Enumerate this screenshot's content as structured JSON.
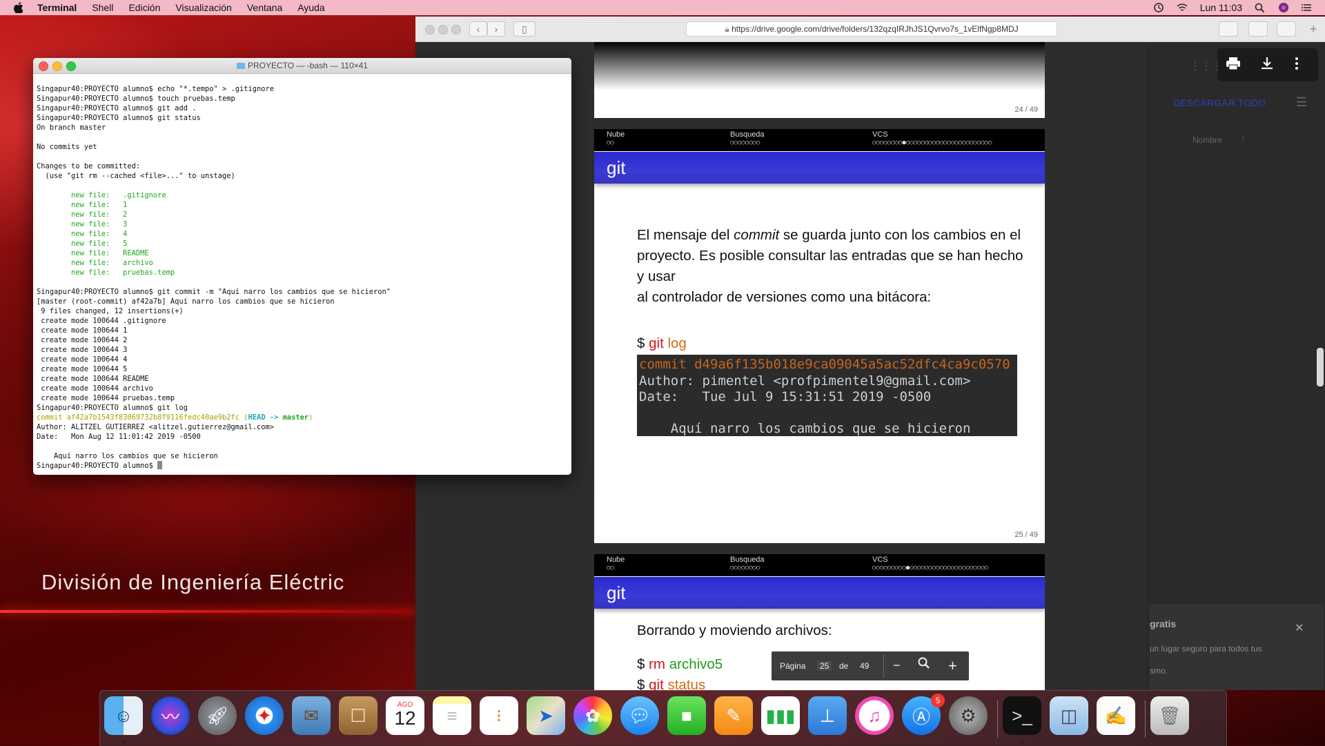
{
  "menubar": {
    "app": "Terminal",
    "items": [
      "Shell",
      "Edición",
      "Visualización",
      "Ventana",
      "Ayuda"
    ],
    "clock": "Lun 11:03"
  },
  "desktop": {
    "wallpaper_text": "División de Ingeniería Eléctric"
  },
  "browser": {
    "url": "https://drive.google.com/drive/folders/132qzqIRJhJS1Qvrvo7s_1vElfNgp8MDJ",
    "download_all": "DESCARGAR TODO",
    "column_name": "Nombre",
    "promo_title": "gratis",
    "promo_lines": [
      "un lugar seguro para todos tus",
      "smo."
    ],
    "pager": {
      "label": "Página",
      "current": "25",
      "of": "de",
      "total": "49"
    }
  },
  "slides": [
    {
      "page": "24 / 49"
    },
    {
      "sections": [
        {
          "name": "Nube",
          "dots": "○○"
        },
        {
          "name": "Busqueda",
          "dots": "○○○○○○○○"
        },
        {
          "name": "VCS",
          "dots": "○○○○○○○○●○○○○○○○○○○○○○○○○○○○○○○○"
        }
      ],
      "title": "git",
      "text": "El mensaje del commit se guarda junto con los cambios en el proyecto. Es posible consultar las entradas que se han hecho y usar al controlador de versiones como una bitácora:",
      "text_parts": {
        "a": "El mensaje del ",
        "em": "commit",
        "b": " se guarda junto con los cambios en el",
        "line2": "proyecto. Es posible consultar las entradas que se han hecho y usar",
        "line3": "al controlador de versiones como una bitácora:"
      },
      "command": {
        "prompt": "$",
        "cmd": "git",
        "arg": "log"
      },
      "terminal_lines": [
        "commit d49a6f135b018e9ca09045a5ac52dfc4ca9c0570",
        "Author: pimentel <profpimentel9@gmail.com>",
        "Date:   Tue Jul 9 15:31:51 2019 -0500",
        "    Aquí narro los cambios que se hicieron"
      ],
      "page": "25 / 49"
    },
    {
      "sections": [
        {
          "name": "Nube",
          "dots": "○○"
        },
        {
          "name": "Busqueda",
          "dots": "○○○○○○○○"
        },
        {
          "name": "VCS",
          "dots": "○○○○○○○○○●○○○○○○○○○○○○○○○○○○○○○"
        }
      ],
      "title": "git",
      "text": "Borrando y moviendo archivos:",
      "commands": [
        {
          "prompt": "$",
          "cmd": "rm",
          "arg": "archivo5"
        },
        {
          "prompt": "$",
          "cmd": "git",
          "arg": "status"
        }
      ]
    }
  ],
  "terminal": {
    "title": "PROYECTO — -bash — 110×41",
    "lines": [
      {
        "t": "Singapur40:PROYECTO alumno$ echo \"*.tempo\" > .gitignore",
        "c": ""
      },
      {
        "t": "Singapur40:PROYECTO alumno$ touch pruebas.temp",
        "c": ""
      },
      {
        "t": "Singapur40:PROYECTO alumno$ git add .",
        "c": ""
      },
      {
        "t": "Singapur40:PROYECTO alumno$ git status",
        "c": ""
      },
      {
        "t": "On branch master",
        "c": ""
      },
      {
        "t": "",
        "c": ""
      },
      {
        "t": "No commits yet",
        "c": ""
      },
      {
        "t": "",
        "c": ""
      },
      {
        "t": "Changes to be committed:",
        "c": ""
      },
      {
        "t": "  (use \"git rm --cached <file>...\" to unstage)",
        "c": ""
      },
      {
        "t": "",
        "c": ""
      },
      {
        "t": "        new file:   .gitignore",
        "c": "tg"
      },
      {
        "t": "        new file:   1",
        "c": "tg"
      },
      {
        "t": "        new file:   2",
        "c": "tg"
      },
      {
        "t": "        new file:   3",
        "c": "tg"
      },
      {
        "t": "        new file:   4",
        "c": "tg"
      },
      {
        "t": "        new file:   5",
        "c": "tg"
      },
      {
        "t": "        new file:   README",
        "c": "tg"
      },
      {
        "t": "        new file:   archivo",
        "c": "tg"
      },
      {
        "t": "        new file:   pruebas.temp",
        "c": "tg"
      },
      {
        "t": "",
        "c": ""
      },
      {
        "t": "Singapur40:PROYECTO alumno$ git commit -m \"Aquí narro los cambios que se hicieron\"",
        "c": ""
      },
      {
        "t": "[master (root-commit) af42a7b] Aquí narro los cambios que se hicieron",
        "c": ""
      },
      {
        "t": " 9 files changed, 12 insertions(+)",
        "c": ""
      },
      {
        "t": " create mode 100644 .gitignore",
        "c": ""
      },
      {
        "t": " create mode 100644 1",
        "c": ""
      },
      {
        "t": " create mode 100644 2",
        "c": ""
      },
      {
        "t": " create mode 100644 3",
        "c": ""
      },
      {
        "t": " create mode 100644 4",
        "c": ""
      },
      {
        "t": " create mode 100644 5",
        "c": ""
      },
      {
        "t": " create mode 100644 README",
        "c": ""
      },
      {
        "t": " create mode 100644 archivo",
        "c": ""
      },
      {
        "t": " create mode 100644 pruebas.temp",
        "c": ""
      },
      {
        "t": "Singapur40:PROYECTO alumno$ git log",
        "c": ""
      },
      {
        "t": "COMMITLINE",
        "c": "commit"
      },
      {
        "t": "Author: ALITZEL GUTIERREZ <alitzel.gutierrez@gmail.com>",
        "c": ""
      },
      {
        "t": "Date:   Mon Aug 12 11:01:42 2019 -0500",
        "c": ""
      },
      {
        "t": "",
        "c": ""
      },
      {
        "t": "    Aquí narro los cambios que se hicieron",
        "c": ""
      },
      {
        "t": "Singapur40:PROYECTO alumno$ ",
        "c": "prompt"
      }
    ],
    "commit_line": {
      "hash": "commit af42a7b1543f83069732b8f9116fedc40ae9b2fc",
      "open": " (",
      "head": "HEAD -> master",
      "close": ")"
    }
  },
  "dock": {
    "calendar_month": "AGO",
    "calendar_day": "12",
    "appstore_badge": "5",
    "apps": [
      "Finder",
      "Siri",
      "Launchpad",
      "Safari",
      "Mail",
      "Contacts",
      "Calendar",
      "Notes",
      "Reminders",
      "Maps",
      "Photos",
      "Messages",
      "FaceTime",
      "Pages",
      "Numbers",
      "Keynote",
      "iTunes",
      "App Store",
      "System Preferences",
      "Terminal",
      "Preview",
      "TextEdit",
      "Trash"
    ]
  },
  "colors": {
    "menubar": "#f3b9c4",
    "slide_title": "#3333cc",
    "git_cmd": "#d0141a",
    "git_arg": "#d66a12",
    "arg_green": "#1e9a1e"
  }
}
